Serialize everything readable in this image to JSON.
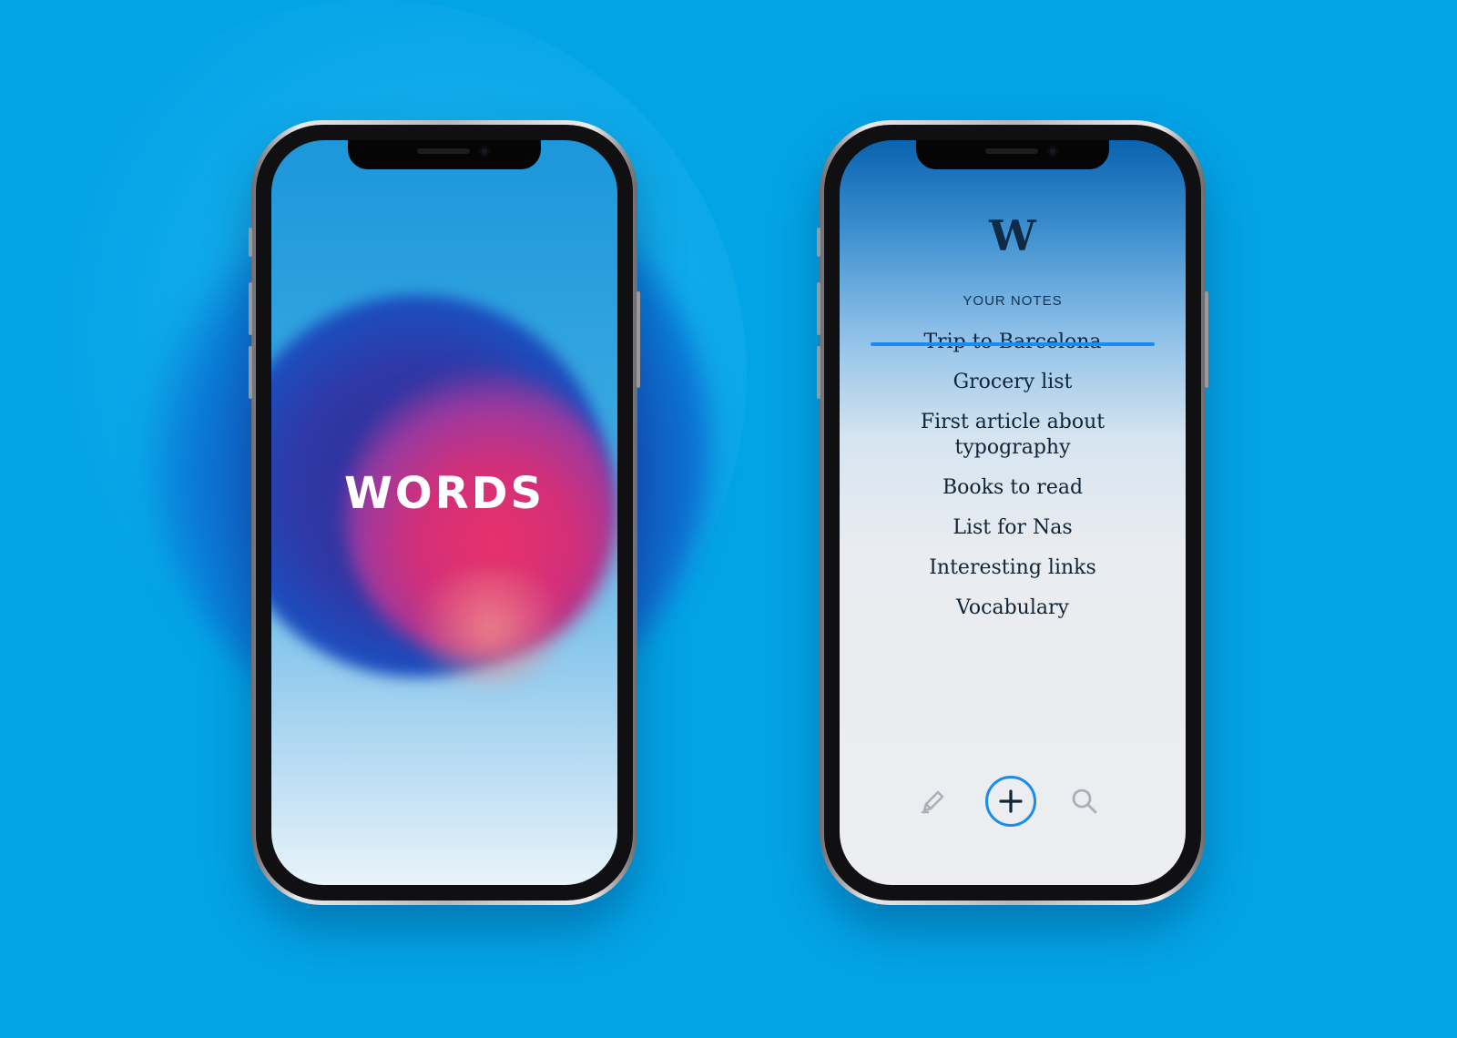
{
  "splash": {
    "logo": "WORDS"
  },
  "notes": {
    "logo": "W",
    "heading": "YOUR NOTES",
    "items": [
      {
        "label": "Trip to Barcelona",
        "completed": true
      },
      {
        "label": "Grocery list",
        "completed": false
      },
      {
        "label": "First article about typography",
        "completed": false
      },
      {
        "label": "Books to read",
        "completed": false
      },
      {
        "label": "List for Nas",
        "completed": false
      },
      {
        "label": "Interesting links",
        "completed": false
      },
      {
        "label": "Vocabulary",
        "completed": false
      }
    ],
    "toolbar": {
      "edit_icon": "pencil-icon",
      "add_icon": "plus-icon",
      "search_icon": "search-icon"
    }
  },
  "colors": {
    "background": "#03a4e6",
    "accent": "#1a8cf0",
    "text_dark": "#0f2436",
    "icon_gray": "#a9b0b8"
  }
}
